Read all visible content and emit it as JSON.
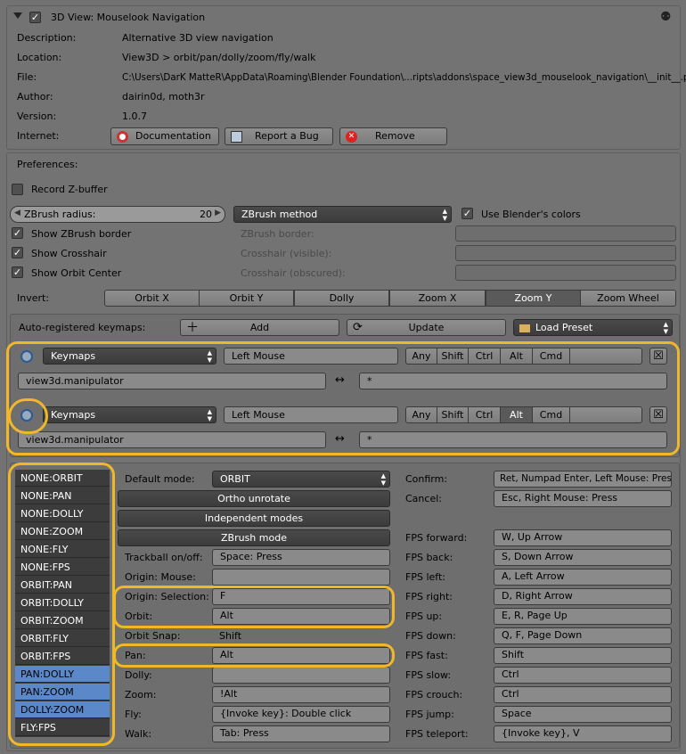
{
  "addon": {
    "title": "3D View: Mouselook Navigation",
    "info": [
      {
        "label": "Description:",
        "value": "Alternative 3D view navigation"
      },
      {
        "label": "Location:",
        "value": "View3D > orbit/pan/dolly/zoom/fly/walk"
      },
      {
        "label": "File:",
        "value": "C:\\Users\\DarK MatteR\\AppData\\Roaming\\Blender Foundation\\...ripts\\addons\\space_view3d_mouselook_navigation\\__init__.py"
      },
      {
        "label": "Author:",
        "value": "dairin0d, moth3r"
      },
      {
        "label": "Version:",
        "value": "1.0.7"
      }
    ],
    "internet_label": "Internet:",
    "documentation": "Documentation",
    "report_bug": "Report a Bug",
    "remove": "Remove"
  },
  "prefs": {
    "title": "Preferences:",
    "record_zbuffer": "Record Z-buffer",
    "zbrush_radius_label": "ZBrush radius:",
    "zbrush_radius_value": "20",
    "zbrush_method": "ZBrush method",
    "use_blender_colors": "Use Blender's colors",
    "show_zbrush_border": "Show ZBrush border",
    "show_crosshair": "Show Crosshair",
    "show_orbit_center": "Show Orbit Center",
    "zbrush_border": "ZBrush border:",
    "crosshair_visible": "Crosshair (visible):",
    "crosshair_obscured": "Crosshair (obscured):",
    "invert_label": "Invert:",
    "invert_options": [
      "Orbit X",
      "Orbit Y",
      "Dolly",
      "Zoom X",
      "Zoom Y",
      "Zoom Wheel"
    ],
    "invert_active": "Zoom Y",
    "auto_keymaps": "Auto-registered keymaps:",
    "add": "Add",
    "update": "Update",
    "load_preset": "Load Preset"
  },
  "keymaps": [
    {
      "type": "Keymaps",
      "key": "Left Mouse",
      "mods": [
        "Any",
        "Shift",
        "Ctrl",
        "Alt",
        "Cmd"
      ],
      "active_mod": "",
      "operator": "view3d.manipulator",
      "mode": "*"
    },
    {
      "type": "Keymaps",
      "key": "Left Mouse",
      "mods": [
        "Any",
        "Shift",
        "Ctrl",
        "Alt",
        "Cmd"
      ],
      "active_mod": "Alt",
      "operator": "view3d.manipulator",
      "mode": "*"
    }
  ],
  "swap_symbol": "↔",
  "modes": [
    "NONE:ORBIT",
    "NONE:PAN",
    "NONE:DOLLY",
    "NONE:ZOOM",
    "NONE:FLY",
    "NONE:FPS",
    "ORBIT:PAN",
    "ORBIT:DOLLY",
    "ORBIT:ZOOM",
    "ORBIT:FLY",
    "ORBIT:FPS",
    "PAN:DOLLY",
    "PAN:ZOOM",
    "DOLLY:ZOOM",
    "FLY:FPS"
  ],
  "modes_selected": [
    "PAN:DOLLY",
    "PAN:ZOOM",
    "DOLLY:ZOOM"
  ],
  "mid": {
    "default_mode_label": "Default mode:",
    "default_mode": "ORBIT",
    "ortho_unrotate": "Ortho unrotate",
    "independent_modes": "Independent modes",
    "zbrush_mode": "ZBrush mode",
    "rows": [
      {
        "label": "Trackball on/off:",
        "value": "Space: Press"
      },
      {
        "label": "Origin: Mouse:",
        "value": ""
      },
      {
        "label": "Origin: Selection:",
        "value": "F"
      },
      {
        "label": "Orbit:",
        "value": "Alt"
      },
      {
        "label": "Orbit Snap:",
        "value": "Shift"
      },
      {
        "label": "Pan:",
        "value": "Alt"
      },
      {
        "label": "Dolly:",
        "value": ""
      },
      {
        "label": "Zoom:",
        "value": "!Alt"
      },
      {
        "label": "Fly:",
        "value": "{Invoke key}: Double click"
      },
      {
        "label": "Walk:",
        "value": "Tab: Press"
      }
    ]
  },
  "right": {
    "confirm_label": "Confirm:",
    "confirm": "Ret, Numpad Enter, Left Mouse: Press",
    "cancel_label": "Cancel:",
    "cancel": "Esc, Right Mouse: Press",
    "rows": [
      {
        "label": "FPS forward:",
        "value": "W, Up Arrow"
      },
      {
        "label": "FPS back:",
        "value": "S, Down Arrow"
      },
      {
        "label": "FPS left:",
        "value": "A, Left Arrow"
      },
      {
        "label": "FPS right:",
        "value": "D, Right Arrow"
      },
      {
        "label": "FPS up:",
        "value": "E, R, Page Up"
      },
      {
        "label": "FPS down:",
        "value": "Q, F, Page Down"
      },
      {
        "label": "FPS fast:",
        "value": "Shift"
      },
      {
        "label": "FPS slow:",
        "value": "Ctrl"
      },
      {
        "label": "FPS crouch:",
        "value": "Ctrl"
      },
      {
        "label": "FPS jump:",
        "value": "Space"
      },
      {
        "label": "FPS teleport:",
        "value": "{Invoke key}, V"
      }
    ]
  },
  "colors": {
    "highlight": "#f0b828",
    "selected_mode": "#5b88c8"
  }
}
